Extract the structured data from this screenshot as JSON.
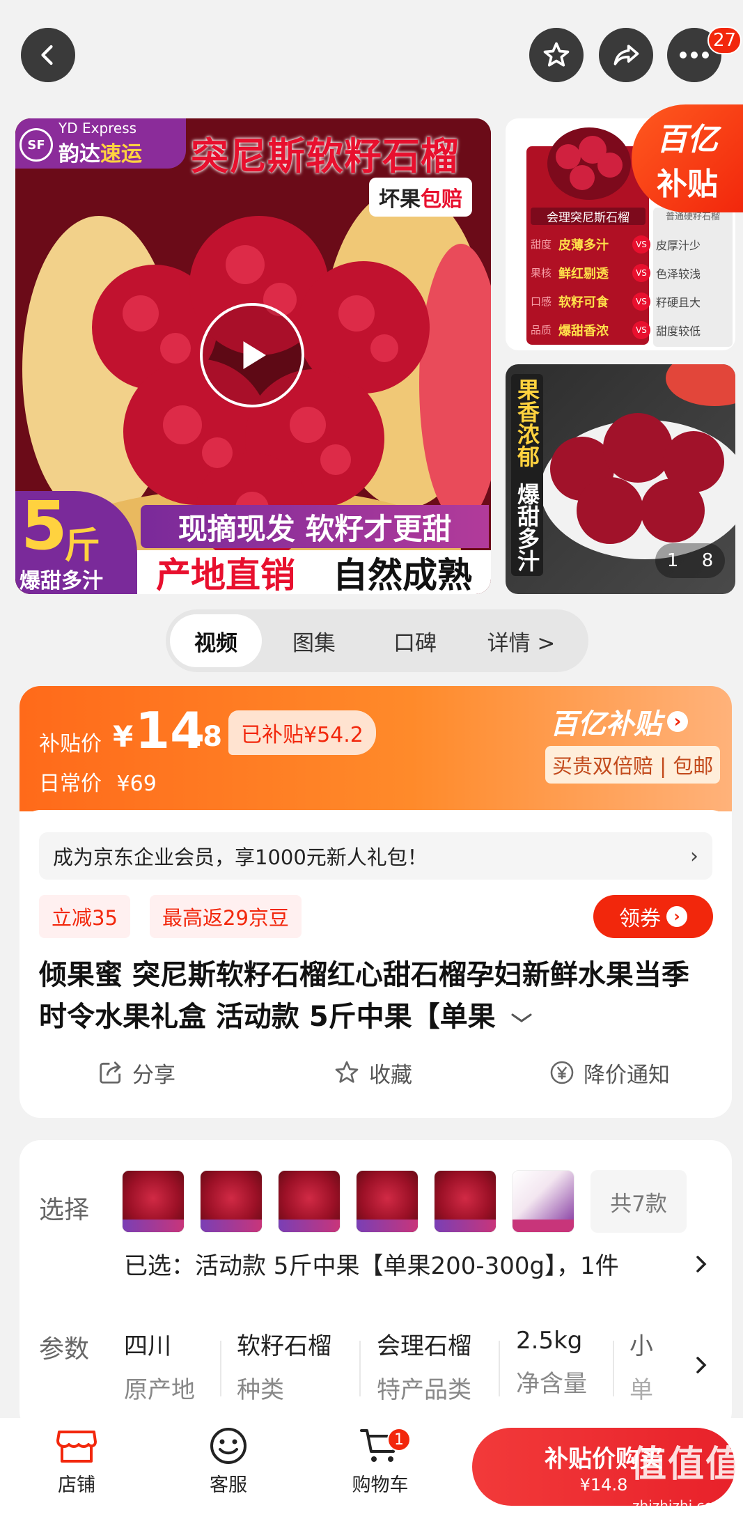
{
  "topbar": {
    "cart_badge": "27"
  },
  "gallery": {
    "main": {
      "express_en": "YD Express",
      "express_sf": "SF",
      "express_cn_a": "韵达",
      "express_cn_b": "速运",
      "headline": "突尼斯软籽石榴",
      "guarantee_a": "坏果",
      "guarantee_b": "包赔",
      "weight_num": "5",
      "weight_unit": "斤",
      "weight_sub": "爆甜多汁",
      "slogan_1": "现摘现发 软籽才更甜",
      "slogan_2a": "产地直销",
      "slogan_2b": "自然成熟"
    },
    "side1": {
      "subsidy_badge_1": "百亿",
      "subsidy_badge_2": "补贴",
      "left_head": "会理突尼斯石榴",
      "right_head": "普通硬籽石榴",
      "rows": [
        {
          "k": "甜度",
          "l": "皮薄多汁",
          "r": "皮厚汁少"
        },
        {
          "k": "果核",
          "l": "鲜红剔透",
          "r": "色泽较浅"
        },
        {
          "k": "口感",
          "l": "软籽可食",
          "r": "籽硬且大"
        },
        {
          "k": "品质",
          "l": "爆甜香浓",
          "r": "甜度较低"
        }
      ],
      "vs": "VS"
    },
    "side2": {
      "vertical_1": "果香浓郁",
      "vertical_2": "爆甜多汁",
      "pager_current": "1",
      "pager_total": "8"
    }
  },
  "tabs": [
    "视频",
    "图集",
    "口碑",
    "详情 >"
  ],
  "price": {
    "label": "补贴价",
    "currency": "¥",
    "int": "14",
    "dec": ".8",
    "subsidy_tag": "已补贴¥54.2",
    "daily_label": "日常价",
    "daily_value": "¥69",
    "brand_1": "百亿补贴",
    "brand_arrow": "›",
    "brand_sub": "买贵双倍赔 | 包邮"
  },
  "member_bar": {
    "text": "成为京东企业会员，享1000元新人礼包！",
    "arrow": "›"
  },
  "tags": [
    "立减35",
    "最高返29京豆"
  ],
  "coupon_label": "领券",
  "product_title": "倾果蜜 突尼斯软籽石榴红心甜石榴孕妇新鲜水果当季时令水果礼盒 活动款 5斤中果【单果",
  "actions": {
    "share": "分享",
    "favorite": "收藏",
    "price_alert": "降价通知"
  },
  "spec": {
    "select_label": "选择",
    "thumb_count": 6,
    "total_styles": "共7款",
    "selected_text": "已选：活动款 5斤中果【单果200-300g】，1件",
    "params_label": "参数",
    "params": [
      {
        "value": "四川",
        "key": "原产地"
      },
      {
        "value": "软籽石榴",
        "key": "种类"
      },
      {
        "value": "会理石榴",
        "key": "特产品类"
      },
      {
        "value": "2.5kg",
        "key": "净含量"
      },
      {
        "value": "小",
        "key": "单"
      }
    ]
  },
  "bottom": {
    "store": "店铺",
    "service": "客服",
    "cart": "购物车",
    "cart_badge": "1",
    "buy_label": "补贴价购买",
    "buy_price": "¥14.8"
  },
  "watermark": "值|什么值得买",
  "watermark_url": "zhizhizhi.com"
}
